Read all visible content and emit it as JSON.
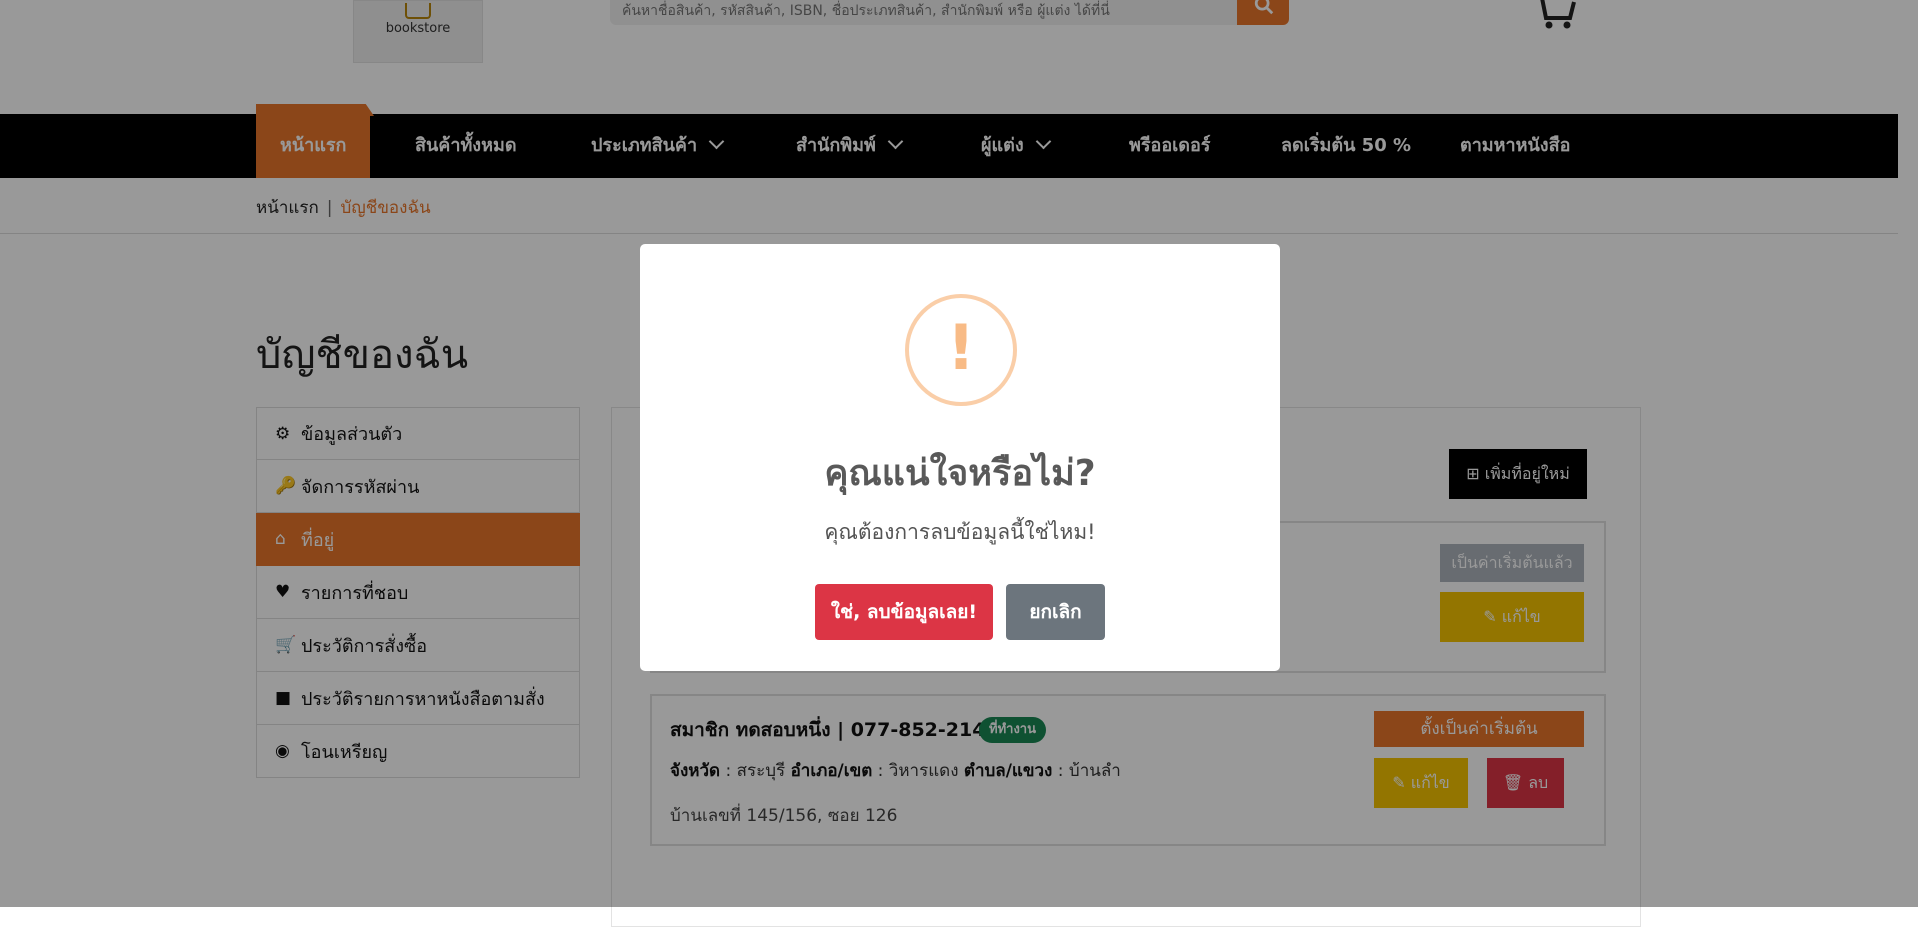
{
  "header": {
    "logo_text": "bookstore",
    "search_placeholder": "ค้นหาชื่อสินค้า, รหัสสินค้า, ISBN, ชื่อประเภทสินค้า, สำนักพิมพ์ หรือ ผู้แต่ง ได้ที่นี่"
  },
  "nav": {
    "home": "หน้าแรก",
    "all_products": "สินค้าทั้งหมด",
    "categories": "ประเภทสินค้า",
    "publishers": "สำนักพิมพ์",
    "authors": "ผู้แต่ง",
    "preorder": "พรีออเดอร์",
    "discount": "ลดเริ่มต้น 50 %",
    "find_book": "ตามหาหนังสือ"
  },
  "breadcrumb": {
    "home": "หน้าแรก",
    "separator": "|",
    "current": "บัญชีของฉัน"
  },
  "page_title": "บัญชีของฉัน",
  "sidebar": {
    "items": [
      {
        "label": "ข้อมูลส่วนตัว"
      },
      {
        "label": "จัดการรหัสผ่าน"
      },
      {
        "label": "ที่อยู่"
      },
      {
        "label": "รายการที่ชอบ"
      },
      {
        "label": "ประวัติการสั่งซื้อ"
      },
      {
        "label": "ประวัติรายการหาหนังสือตามสั่ง"
      },
      {
        "label": "โอนเหรียญ"
      }
    ]
  },
  "address": {
    "add_button": "เพิ่มที่อยู่ใหม่",
    "card1": {
      "default_label": "เป็นค่าเริ่มต้นแล้ว",
      "edit_label": "แก้ไข"
    },
    "card2": {
      "title": "สมาชิก ทดสอบหนึ่ง | 077-852-2145",
      "badge": "ที่ทำงาน",
      "province_label": "จังหวัด",
      "province": ": สระบุรี",
      "district_label": "อำเภอ/เขต",
      "district": ": วิหารแดง",
      "subdistrict_label": "ตำบล/แขวง",
      "subdistrict": ": บ้านลำ",
      "address_line": "บ้านเลขที่ 145/156, ซอย 126",
      "set_default_label": "ตั้งเป็นค่าเริ่มต้น",
      "edit_label": "แก้ไข",
      "delete_label": "ลบ"
    }
  },
  "modal": {
    "icon": "!",
    "title": "คุณแน่ใจหรือไม่?",
    "text": "คุณต้องการลบข้อมูลนี้ใช่ไหม!",
    "confirm_label": "ใช่, ลบข้อมูลเลย!",
    "cancel_label": "ยกเลิก"
  },
  "colors": {
    "accent": "#e8762a",
    "warning_icon": "#f8bb86",
    "confirm": "#dc3545",
    "cancel": "#6c757d"
  }
}
